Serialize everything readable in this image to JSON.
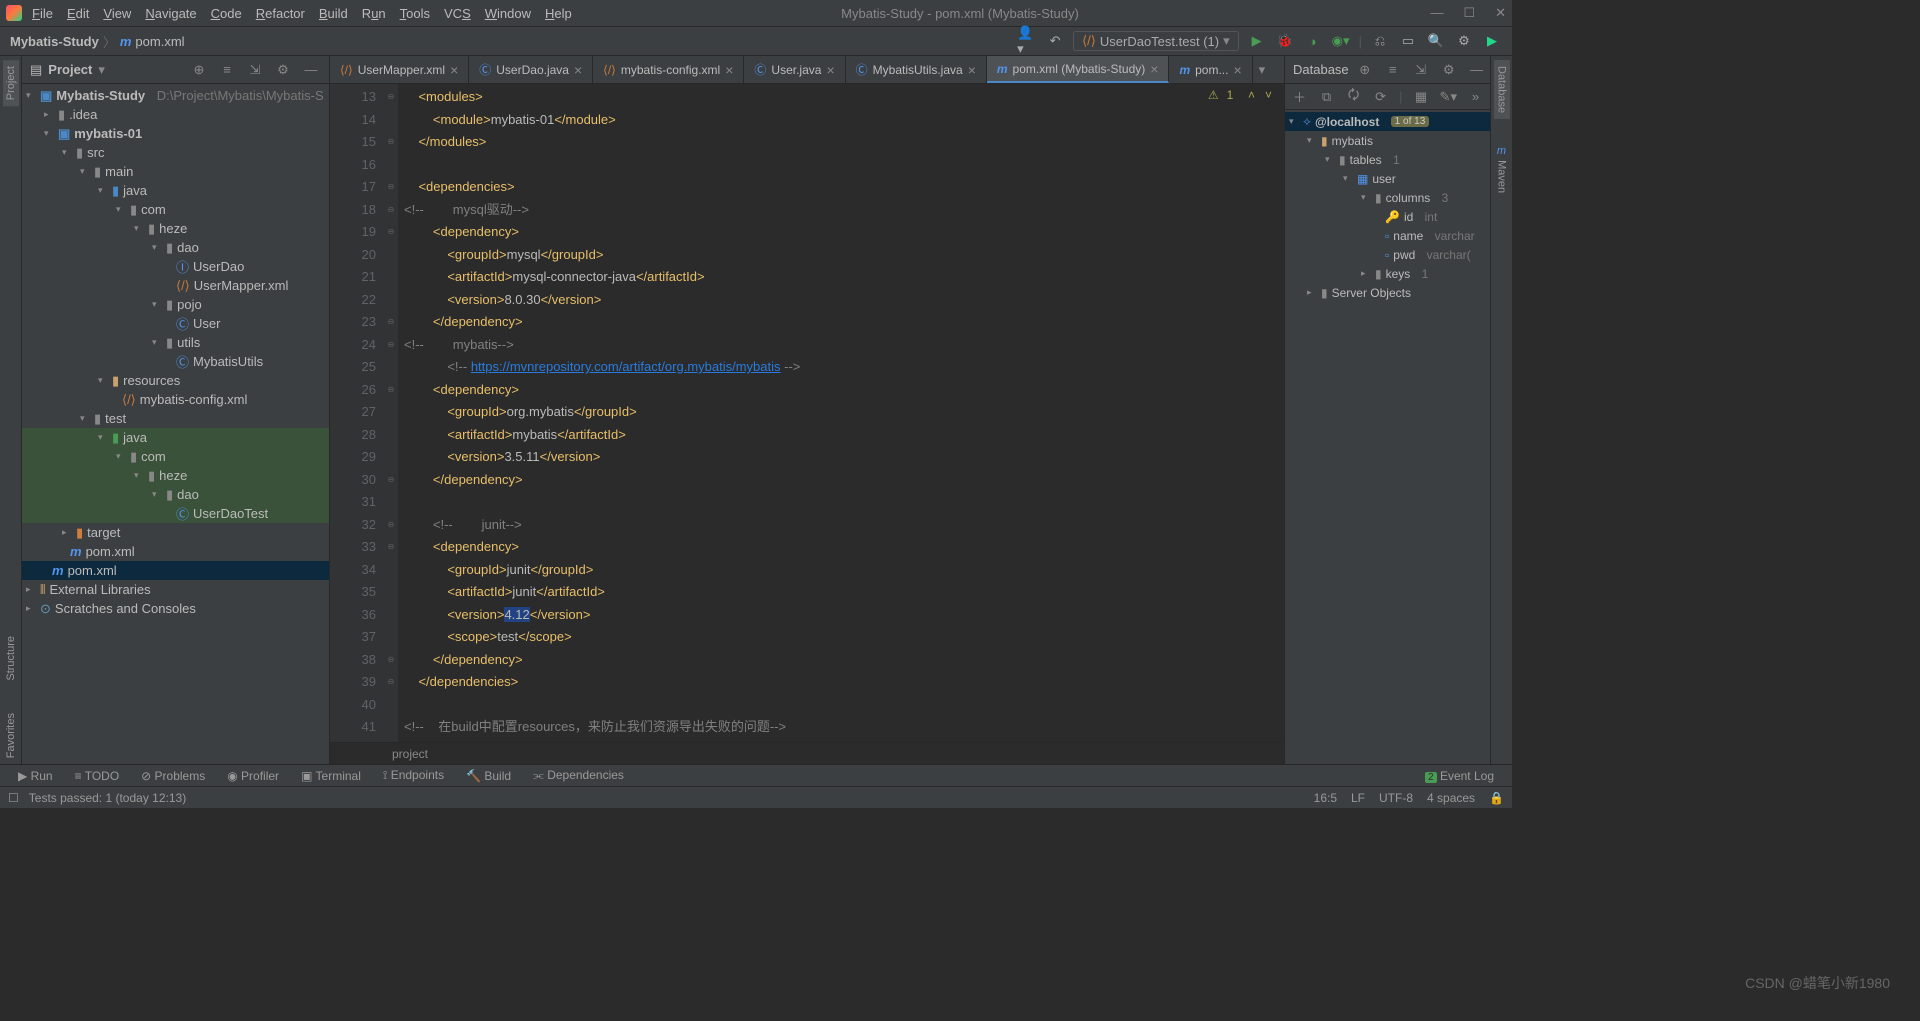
{
  "menu": [
    "File",
    "Edit",
    "View",
    "Navigate",
    "Code",
    "Refactor",
    "Build",
    "Run",
    "Tools",
    "VCS",
    "Window",
    "Help"
  ],
  "window_title": "Mybatis-Study - pom.xml (Mybatis-Study)",
  "breadcrumb": {
    "root": "Mybatis-Study",
    "file": "pom.xml",
    "icon": "m"
  },
  "run_config": "UserDaoTest.test (1)",
  "left_strip": [
    "Project",
    "Structure",
    "Favorites"
  ],
  "right_strip": [
    "Database",
    "Maven"
  ],
  "project_panel": {
    "title": "Project"
  },
  "tree": {
    "root": "Mybatis-Study",
    "root_path": "D:\\Project\\Mybatis\\Mybatis-S",
    "idea": ".idea",
    "m01": "mybatis-01",
    "src": "src",
    "main": "main",
    "java": "java",
    "com": "com",
    "heze": "heze",
    "dao": "dao",
    "userdao": "UserDao",
    "usermapper": "UserMapper.xml",
    "pojo": "pojo",
    "user": "User",
    "utils": "utils",
    "mybatisutils": "MybatisUtils",
    "resources": "resources",
    "mybatiscfg": "mybatis-config.xml",
    "test": "test",
    "java2": "java",
    "com2": "com",
    "heze2": "heze",
    "dao2": "dao",
    "usertest": "UserDaoTest",
    "target": "target",
    "pom1": "pom.xml",
    "pom2": "pom.xml",
    "extlib": "External Libraries",
    "scratches": "Scratches and Consoles"
  },
  "tabs": [
    {
      "icon": "xml",
      "label": "UserMapper.xml"
    },
    {
      "icon": "java",
      "label": "UserDao.java"
    },
    {
      "icon": "xml",
      "label": "mybatis-config.xml"
    },
    {
      "icon": "java",
      "label": "User.java"
    },
    {
      "icon": "java",
      "label": "MybatisUtils.java"
    },
    {
      "icon": "m",
      "label": "pom.xml (Mybatis-Study)",
      "active": true
    },
    {
      "icon": "m",
      "label": "pom..."
    }
  ],
  "code": {
    "startLine": 13,
    "warnings": "1",
    "lines": [
      "    <modules>",
      "        <module>mybatis-01</module>",
      "    </modules>",
      "",
      "    <dependencies>",
      "<!--        mysql驱动-->",
      "        <dependency>",
      "            <groupId>mysql</groupId>",
      "            <artifactId>mysql-connector-java</artifactId>",
      "            <version>8.0.30</version>",
      "        </dependency>",
      "<!--        mybatis-->",
      "            <!-- https://mvnrepository.com/artifact/org.mybatis/mybatis -->",
      "        <dependency>",
      "            <groupId>org.mybatis</groupId>",
      "            <artifactId>mybatis</artifactId>",
      "            <version>3.5.11</version>",
      "        </dependency>",
      "",
      "        <!--        junit-->",
      "        <dependency>",
      "            <groupId>junit</groupId>",
      "            <artifactId>junit</artifactId>",
      "            <version>4.12</version>",
      "            <scope>test</scope>",
      "        </dependency>",
      "    </dependencies>",
      "",
      "<!--    在build中配置resources，来防止我们资源导出失败的问题-->"
    ],
    "breadcrumb": "project"
  },
  "db": {
    "title": "Database",
    "host": "@localhost",
    "host_badge": "1 of 13",
    "schema": "mybatis",
    "tables": "tables",
    "tables_n": "1",
    "user": "user",
    "columns": "columns",
    "columns_n": "3",
    "c1": "id",
    "c1t": "int",
    "c2": "name",
    "c2t": "varchar",
    "c3": "pwd",
    "c3t": "varchar(",
    "keys": "keys",
    "keys_n": "1",
    "srv": "Server Objects"
  },
  "bottom_tools": [
    "Run",
    "TODO",
    "Problems",
    "Profiler",
    "Terminal",
    "Endpoints",
    "Build",
    "Dependencies"
  ],
  "event_log": "Event Log",
  "status": {
    "msg": "Tests passed: 1 (today 12:13)",
    "pos": "16:5",
    "lf": "LF",
    "enc": "UTF-8",
    "sp": "4 spaces"
  },
  "watermark": "CSDN @蜡笔小新1980"
}
